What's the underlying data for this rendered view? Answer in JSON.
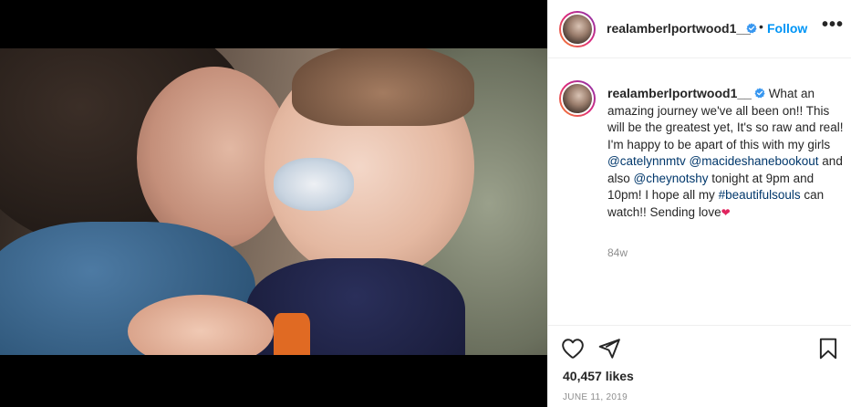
{
  "post": {
    "username": "realamberlportwood1__",
    "follow_label": "Follow",
    "separator": "•",
    "more_label": "•••",
    "caption_segments": [
      {
        "type": "text",
        "value": " What an amazing journey we've all been on!! This will be the greatest yet, It's so raw and real! I'm happy to be apart of this with my girls "
      },
      {
        "type": "mention",
        "value": "@catelynnmtv"
      },
      {
        "type": "text",
        "value": " "
      },
      {
        "type": "mention",
        "value": "@macideshanebookout"
      },
      {
        "type": "text",
        "value": " and also "
      },
      {
        "type": "mention",
        "value": "@cheynotshy"
      },
      {
        "type": "text",
        "value": " tonight at 9pm and 10pm! I hope all my "
      },
      {
        "type": "hashtag",
        "value": "#beautifulsouls"
      },
      {
        "type": "text",
        "value": " can watch!! Sending love"
      },
      {
        "type": "emoji",
        "value": "❤"
      }
    ],
    "relative_time": "84w",
    "likes": "40,457 likes",
    "date": "JUNE 11, 2019"
  },
  "icons": {
    "verified": "verified-badge-icon",
    "like": "heart-icon",
    "share": "paper-plane-icon",
    "save": "bookmark-icon"
  },
  "colors": {
    "accent": "#0095f6",
    "link": "#00376b",
    "muted": "#8e8e8e",
    "heart": "#e0245e",
    "media_background": "#000000"
  }
}
